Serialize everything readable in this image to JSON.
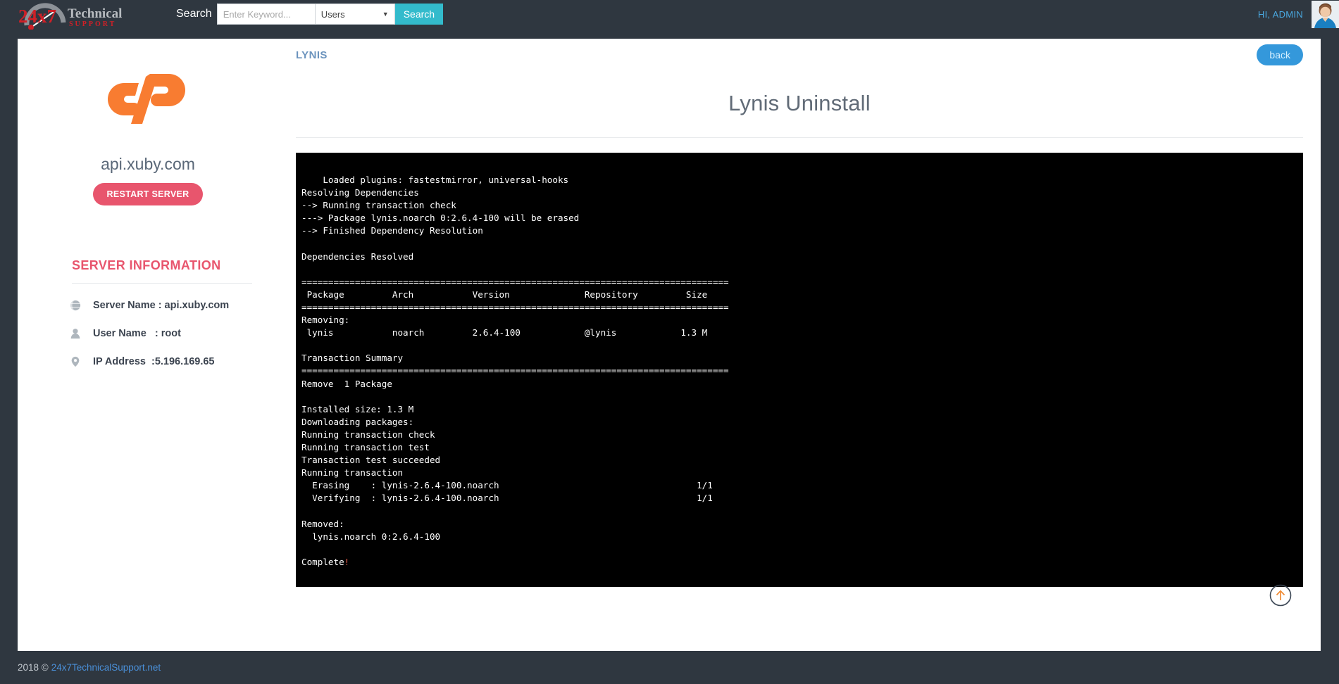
{
  "topbar": {
    "logo_main": "24x7",
    "logo_sub_1": "Technical",
    "logo_sub_2": "S U P P O R T",
    "search_label": "Search",
    "search_placeholder": "Enter Keyword...",
    "search_value": "",
    "scope_selected": "Users",
    "scope_options": [
      "Users"
    ],
    "search_button": "Search",
    "admin_greeting": "HI, ADMIN",
    "accent_teal": "#33bbcc",
    "accent_blue": "#4aa8e0",
    "bar_bg": "#2f3740"
  },
  "sidebar": {
    "brand_logo": "cpanel-logo",
    "server_hostname": "api.xuby.com",
    "restart_button": "RESTART SERVER",
    "restart_color": "#e8556d",
    "section_heading": "SERVER INFORMATION",
    "info": [
      {
        "icon": "globe-icon",
        "label": "Server Name : api.xuby.com"
      },
      {
        "icon": "user-icon",
        "label": "User Name   : root"
      },
      {
        "icon": "location-icon",
        "label": "IP Address  :5.196.169.65"
      }
    ]
  },
  "main": {
    "breadcrumb": "LYNIS",
    "back_button": "back",
    "page_title": "Lynis Uninstall",
    "terminal_output": "    Loaded plugins: fastestmirror, universal-hooks\nResolving Dependencies\n--> Running transaction check\n---> Package lynis.noarch 0:2.6.4-100 will be erased\n--> Finished Dependency Resolution\n\nDependencies Resolved\n\n================================================================================\n Package         Arch           Version              Repository         Size\n================================================================================\nRemoving:\n lynis           noarch         2.6.4-100            @lynis            1.3 M\n\nTransaction Summary\n================================================================================\nRemove  1 Package\n\nInstalled size: 1.3 M\nDownloading packages:\nRunning transaction check\nRunning transaction test\nTransaction test succeeded\nRunning transaction\n  Erasing    : lynis-2.6.4-100.noarch                                     1/1\n  Verifying  : lynis-2.6.4-100.noarch                                     1/1\n\nRemoved:\n  lynis.noarch 0:2.6.4-100\n\nComplete",
    "terminal_output_bang": "!"
  },
  "footer": {
    "copyright": "2018 ©",
    "link_text": "24x7TechnicalSupport.net"
  },
  "scrolltop": {
    "icon": "arrow-up-circle-icon"
  }
}
